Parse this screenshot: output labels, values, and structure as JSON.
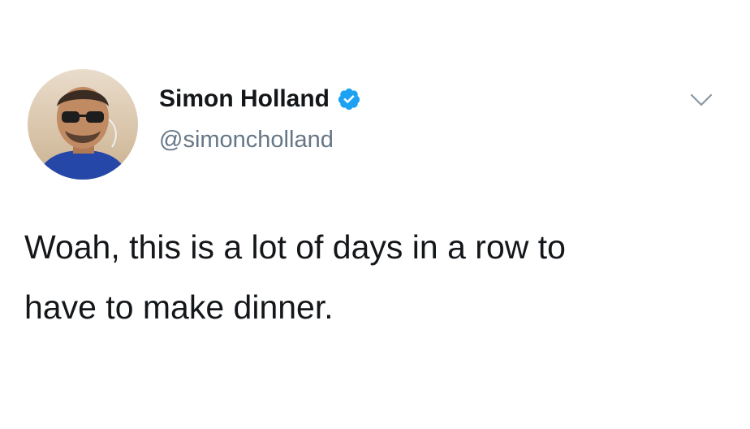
{
  "author": {
    "display_name": "Simon Holland",
    "handle": "@simoncholland",
    "verified": true,
    "verified_color": "#1da1f2"
  },
  "tweet": {
    "text_line_1": "Woah, this is a lot of days in a row to",
    "text_line_2": "have to make dinner."
  },
  "icons": {
    "verified": "verified-badge-icon",
    "menu": "chevron-down-icon"
  },
  "colors": {
    "text": "#14171a",
    "secondary": "#657786",
    "background": "#ffffff"
  }
}
